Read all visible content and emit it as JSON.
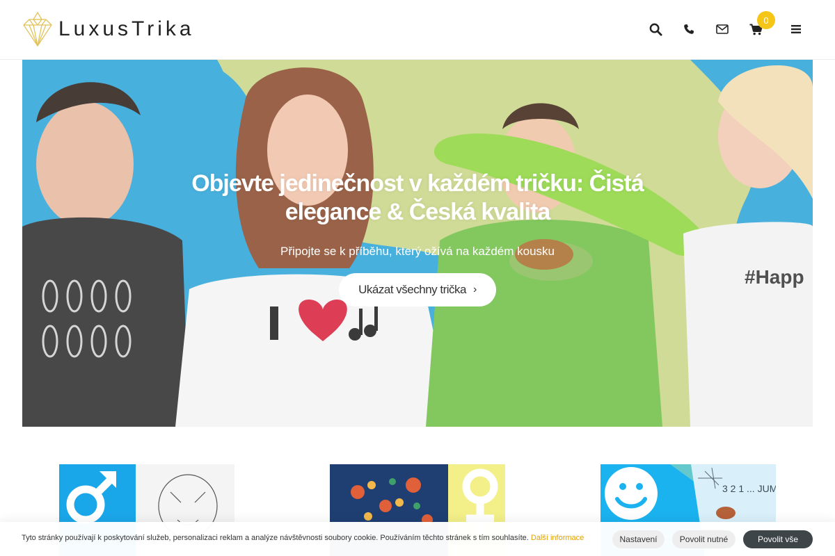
{
  "brand": {
    "name": "LuxusTrika"
  },
  "header": {
    "icons": [
      "search-icon",
      "phone-icon",
      "envelope-icon",
      "cart-icon",
      "menu-icon"
    ],
    "cart_count": "0",
    "accent_color": "#f5c518"
  },
  "hero": {
    "title": "Objevte jedinečnost v každém tričku: Čistá elegance & Česká kvalita",
    "subtitle": "Připojte se k příběhu, který ožívá na každém kousku",
    "button_label": "Ukázat všechny trička",
    "button_icon": "chevron-right-icon"
  },
  "categories": [
    {
      "symbol": "male-symbol-icon",
      "color": "#1aa7ea"
    },
    {
      "symbol": "female-symbol-icon",
      "color": "#f3f08a"
    },
    {
      "symbol": "smiley-icon",
      "color": "#1ab3f0"
    }
  ],
  "cookie": {
    "text": "Tyto stránky používají k poskytování služeb, personalizaci reklam a analýze návštěvnosti soubory cookie. Používáním těchto stránek s tím souhlasíte.",
    "more_link": "Další informace",
    "settings_label": "Nastavení",
    "necessary_label": "Povolit nutné",
    "allow_all_label": "Povolit vše"
  }
}
